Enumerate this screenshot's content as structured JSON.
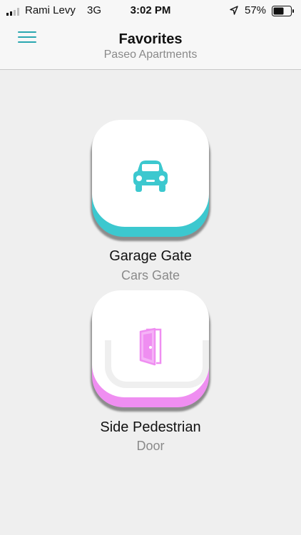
{
  "status_bar": {
    "carrier": "Rami Levy",
    "network": "3G",
    "time": "3:02 PM",
    "battery": "57%"
  },
  "header": {
    "title": "Favorites",
    "subtitle": "Paseo Apartments"
  },
  "favorites": [
    {
      "name": "Garage Gate",
      "subtitle": "Cars Gate",
      "icon": "car-icon",
      "accent_color": "#3cc8cf"
    },
    {
      "name": "Side Pedestrian",
      "subtitle": "Door",
      "icon": "door-icon",
      "accent_color": "#ef8ef1"
    }
  ],
  "colors": {
    "menu_icon": "#2aa7b0",
    "background": "#efefef"
  }
}
